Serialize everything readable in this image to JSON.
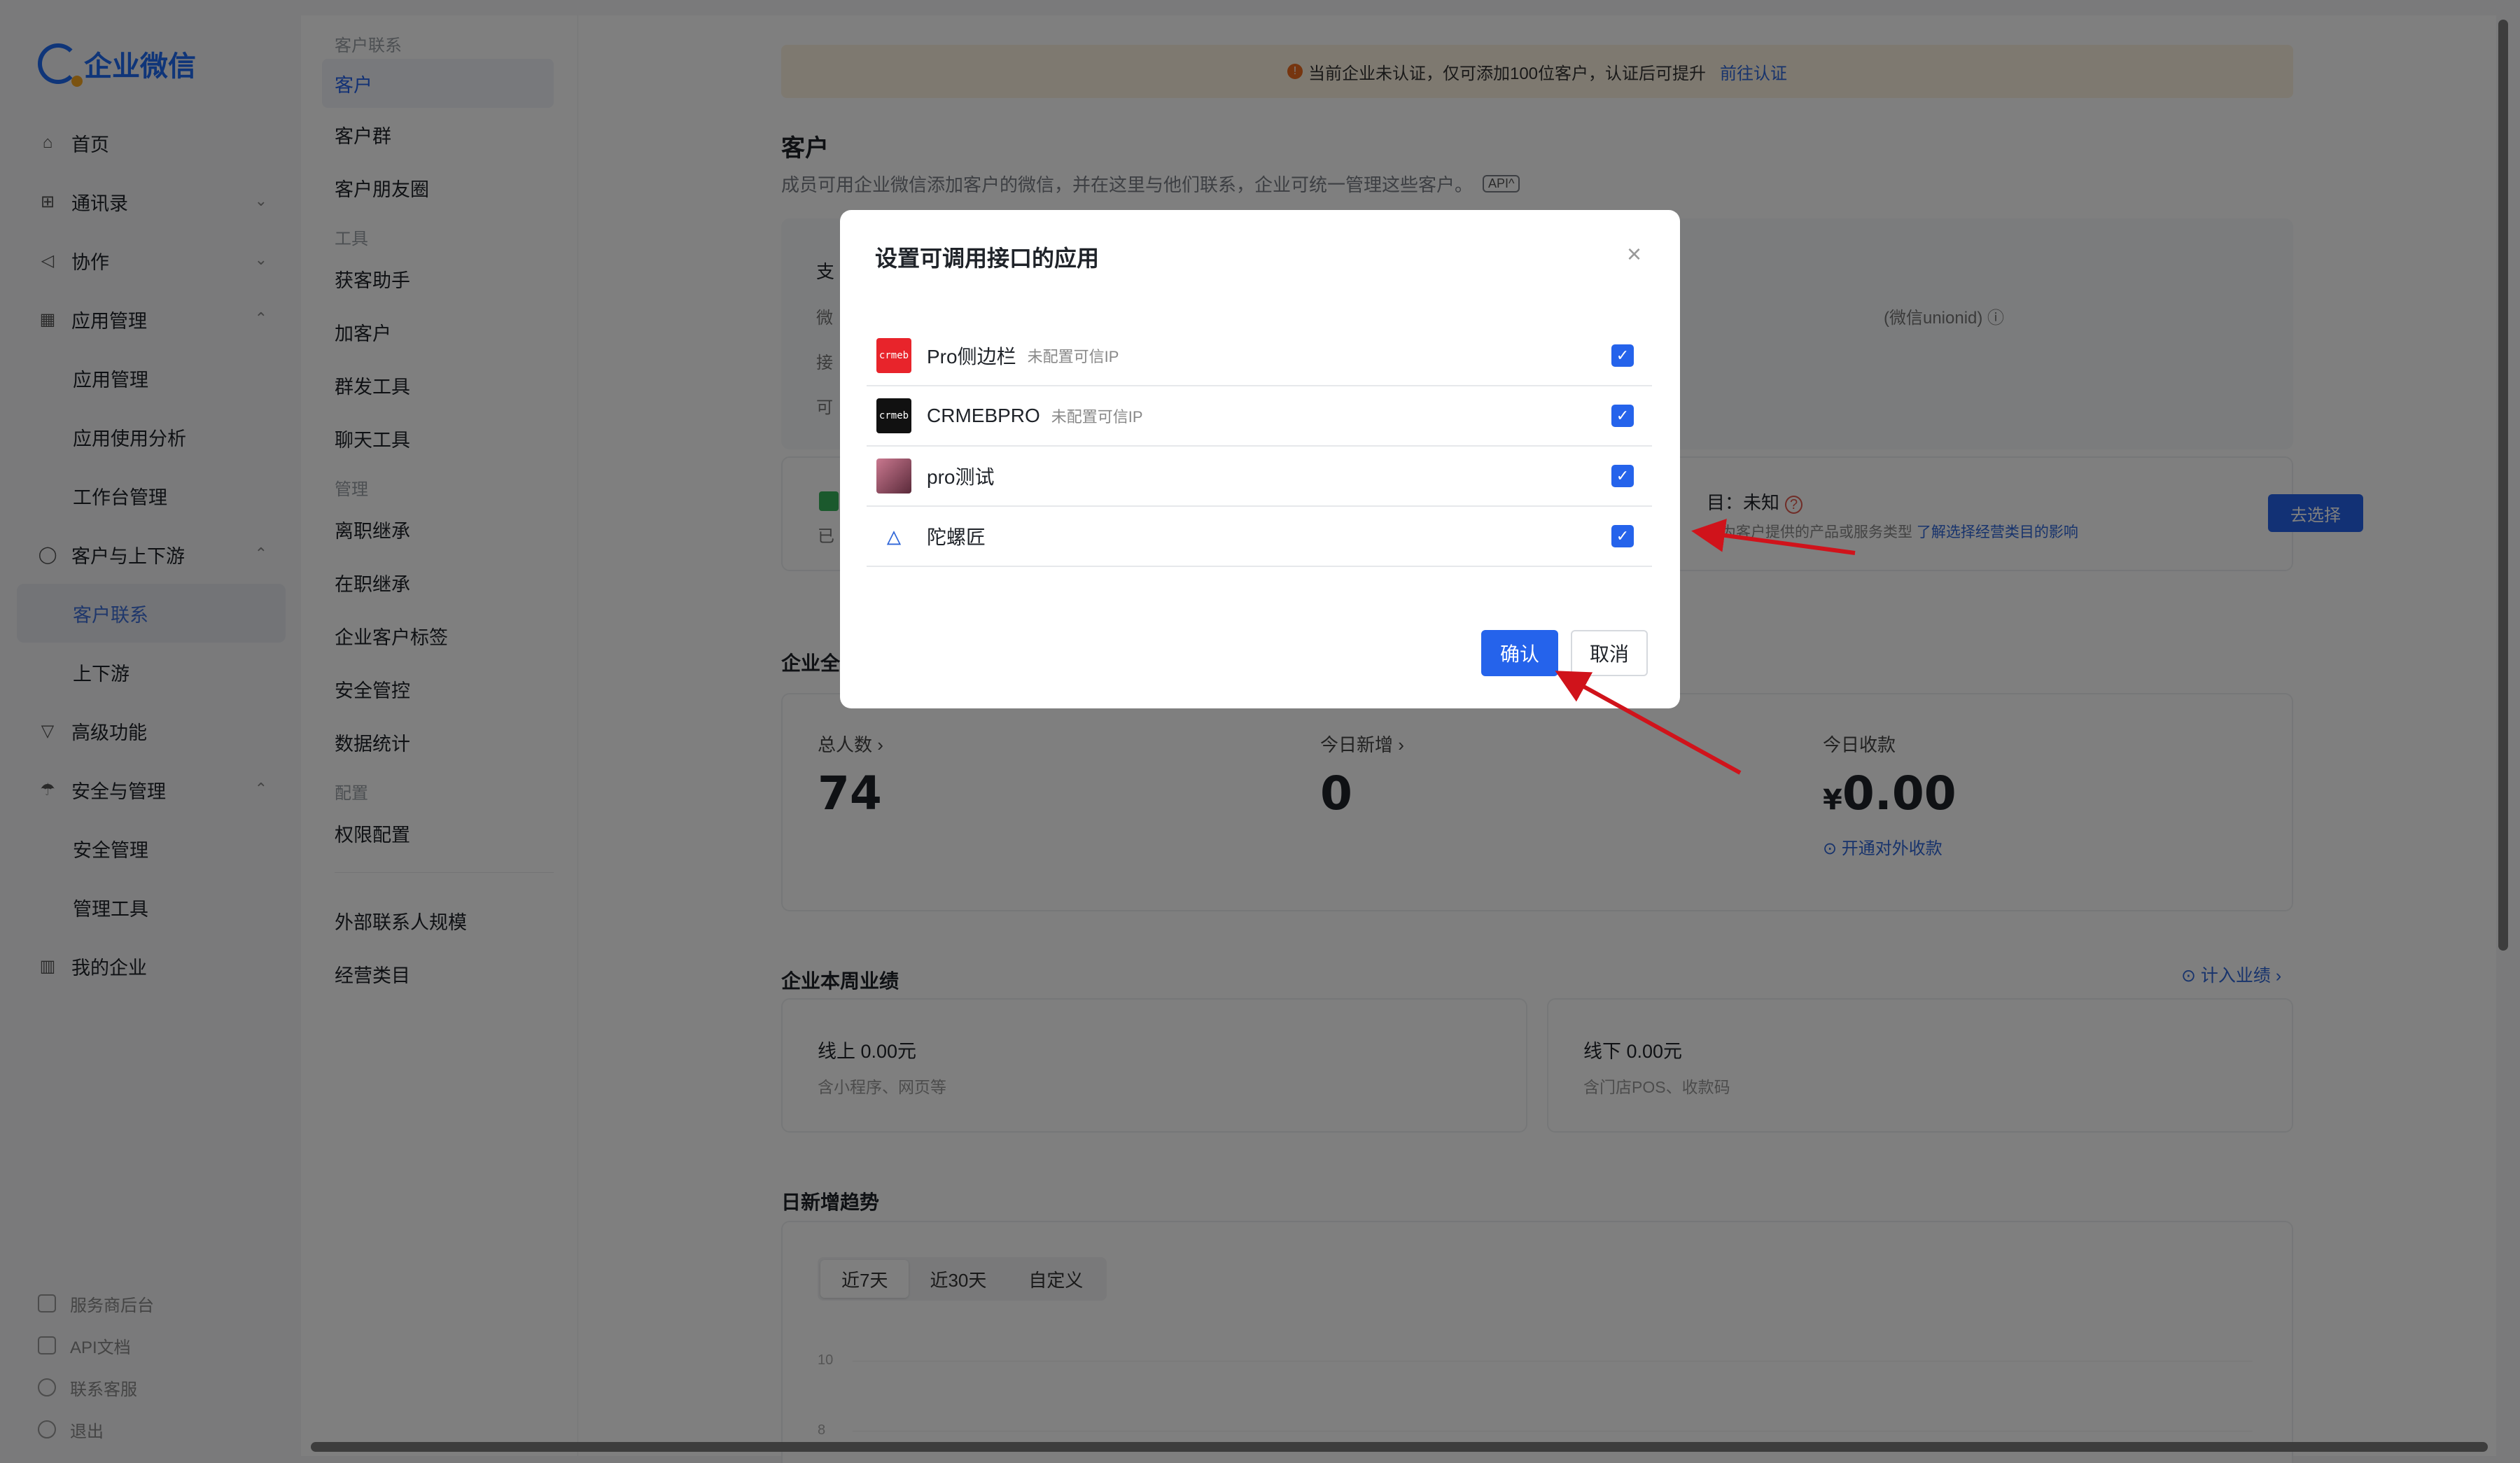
{
  "brand": {
    "name": "企业微信"
  },
  "sidebar": {
    "items": [
      {
        "label": "首页",
        "icon": "home-icon"
      },
      {
        "label": "通讯录",
        "icon": "org-icon",
        "chevron": "⌄"
      },
      {
        "label": "协作",
        "icon": "collab-icon",
        "chevron": "⌄"
      },
      {
        "label": "应用管理",
        "icon": "apps-icon",
        "chevron": "⌃"
      },
      {
        "label": "应用管理",
        "sub": true
      },
      {
        "label": "应用使用分析",
        "sub": true
      },
      {
        "label": "工作台管理",
        "sub": true
      },
      {
        "label": "客户与上下游",
        "icon": "chat-icon",
        "chevron": "⌃"
      },
      {
        "label": "客户联系",
        "sub": true,
        "active": true
      },
      {
        "label": "上下游",
        "sub": true
      },
      {
        "label": "高级功能",
        "icon": "filter-icon"
      },
      {
        "label": "安全与管理",
        "icon": "umbrella-icon",
        "chevron": "⌃"
      },
      {
        "label": "安全管理",
        "sub": true
      },
      {
        "label": "管理工具",
        "sub": true
      },
      {
        "label": "我的企业",
        "icon": "building-icon"
      }
    ],
    "bottom": [
      "服务商后台",
      "API文档",
      "联系客服",
      "退出"
    ]
  },
  "col2": {
    "group1": "客户联系",
    "items1": [
      "客户",
      "客户群",
      "客户朋友圈"
    ],
    "group2": "工具",
    "items2": [
      "获客助手",
      "加客户",
      "群发工具",
      "聊天工具"
    ],
    "group3": "管理",
    "items3": [
      "离职继承",
      "在职继承",
      "企业客户标签",
      "安全管控",
      "数据统计"
    ],
    "group4": "配置",
    "items4": [
      "权限配置"
    ],
    "items5": [
      "外部联系人规模",
      "经营类目"
    ]
  },
  "main": {
    "notice": {
      "text": "当前企业未认证，仅可添加100位客户，认证后可提升",
      "link": "前往认证",
      "icon_char": "!"
    },
    "title": "客户",
    "desc": "成员可用企业微信添加客户的微信，并在这里与他们联系，企业可统一管理这些客户。",
    "api_tag": "API^",
    "card1_fragments": [
      "支",
      "微",
      "接",
      "可",
      "(微信unionid) ⓘ"
    ],
    "card2": {
      "left_frag": "已",
      "cat_label": "目：未知",
      "q": "?",
      "desc_prefix": "业为客户提供的产品或服务类型",
      "desc_link": "了解选择经营类目的影响",
      "button": "去选择"
    },
    "stats_title_frag": "企业全",
    "stats": [
      {
        "label": "总人数 ›",
        "value": "74"
      },
      {
        "label": "今日新增 ›",
        "value": "0"
      },
      {
        "label": "今日收款",
        "currency": "¥",
        "value": "0.00",
        "sub": "⊙ 开通对外收款"
      }
    ],
    "perf_title": "企业本周业绩",
    "perf_link": "⊙ 计入业绩 ›",
    "perf": [
      {
        "a": "线上 0.00元",
        "b": "含小程序、网页等"
      },
      {
        "a": "线下 0.00元",
        "b": "含门店POS、收款码"
      }
    ],
    "trend_title": "日新增趋势",
    "trend_tabs": [
      "近7天",
      "近30天",
      "自定义"
    ],
    "trend_axis": [
      "10",
      "8"
    ]
  },
  "modal": {
    "title": "设置可调用接口的应用",
    "close": "×",
    "apps": [
      {
        "name": "Pro侧边栏",
        "tip": "未配置可信IP",
        "icon_text": "crmeb",
        "icon_color": "#e8242b"
      },
      {
        "name": "CRMEBPRO",
        "tip": "未配置可信IP",
        "icon_text": "crmeb",
        "icon_color": "#111111"
      },
      {
        "name": "pro测试",
        "tip": "",
        "icon_text": "",
        "icon_color": "#7a3b52"
      },
      {
        "name": "陀螺匠",
        "tip": "",
        "icon_text": "△",
        "icon_color": "#ffffff"
      }
    ],
    "check": "✓",
    "confirm": "确认",
    "cancel": "取消"
  },
  "colors": {
    "accent": "#2563eb",
    "annotation_arrow": "#d0131b"
  }
}
